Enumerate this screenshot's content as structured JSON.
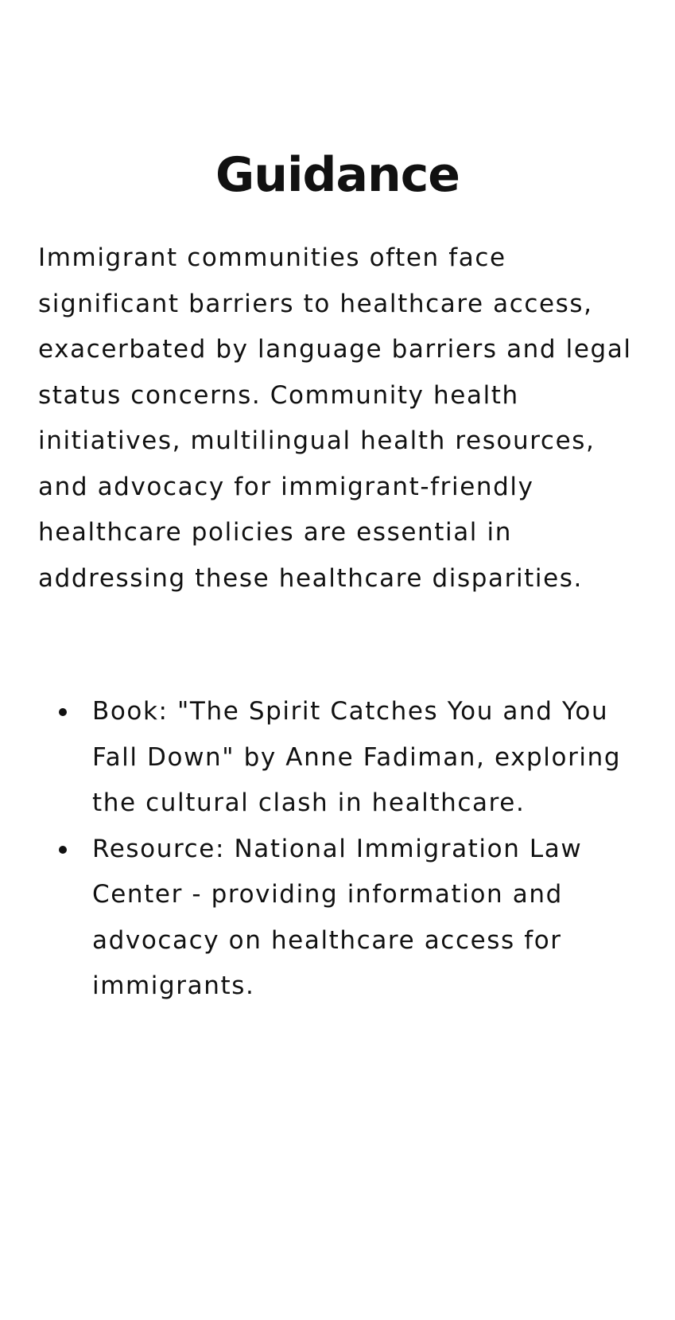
{
  "heading": "Guidance",
  "intro_text": "Immigrant communities often face significant barriers to healthcare access, exacerbated by language barriers and legal status concerns. Community health initiatives, multilingual health resources, and advocacy for immigrant-friendly healthcare policies are essential in addressing these healthcare disparities.",
  "resources": [
    {
      "text": "Book: \"The Spirit Catches You and You Fall Down\" by Anne Fadiman, exploring the cultural clash in healthcare."
    },
    {
      "text": "Resource: National Immigration Law Center - providing information and advocacy on healthcare access for immigrants."
    }
  ],
  "colors": {
    "text": "#111111",
    "background": "#ffffff"
  }
}
